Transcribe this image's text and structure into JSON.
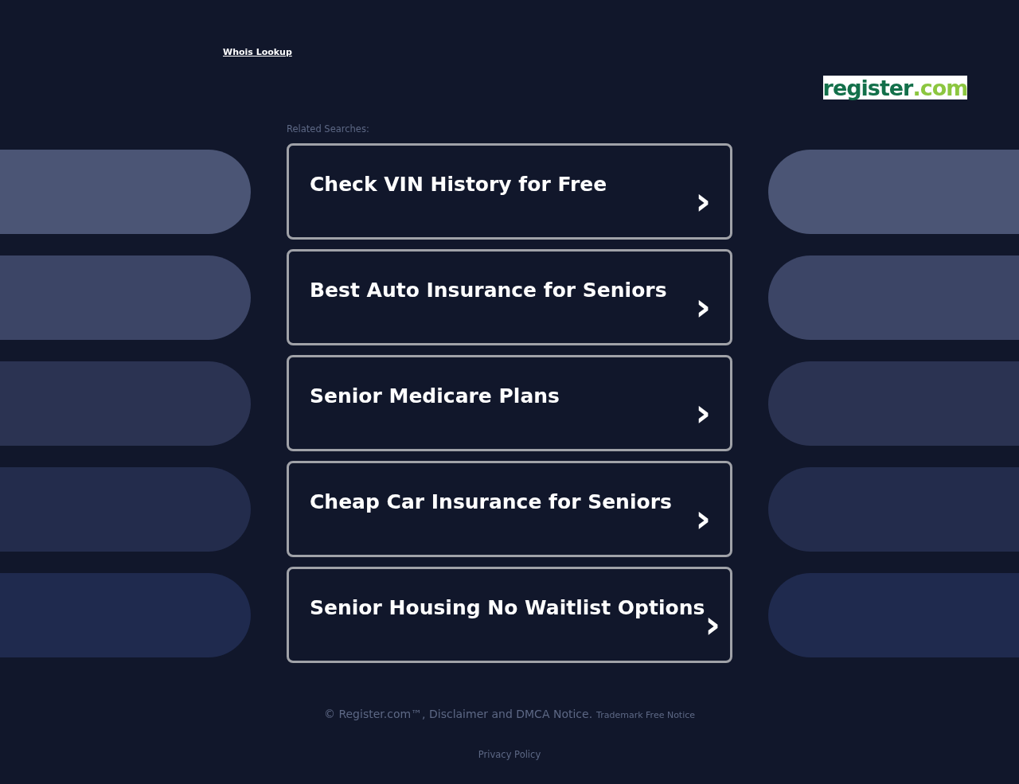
{
  "header": {
    "whois_link": "Whois Lookup",
    "logo": {
      "word": "register",
      "suffix": ".com"
    }
  },
  "related": {
    "heading": "Related Searches:",
    "items": [
      {
        "label": "Check VIN History for Free",
        "arrow": "›"
      },
      {
        "label": "Best Auto Insurance for Seniors",
        "arrow": "›"
      },
      {
        "label": "Senior Medicare Plans",
        "arrow": "›"
      },
      {
        "label": "Cheap Car Insurance for Seniors",
        "arrow": "›"
      },
      {
        "label": "Senior Housing No Waitlist Options",
        "arrow": "›"
      }
    ]
  },
  "footer": {
    "copyright": "© Register.com™, Disclaimer and DMCA Notice.",
    "trademark": "Trademark Free Notice",
    "privacy": "Privacy Policy"
  }
}
